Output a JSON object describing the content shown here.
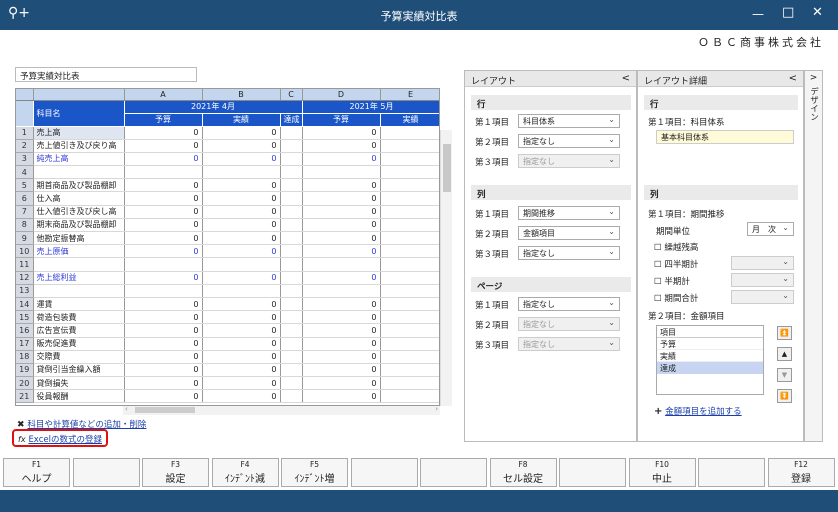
{
  "window": {
    "title": "予算実績対比表",
    "company": "ＯＢＣ商事株式会社"
  },
  "sheet": {
    "name": "予算実績対比表",
    "columns": [
      "A",
      "B",
      "C",
      "D",
      "E"
    ],
    "periods": [
      "2021年 4月",
      "2021年 5月"
    ],
    "subheaders": {
      "account": "科目名",
      "budget": "予算",
      "actual": "実績",
      "rate": "達成"
    },
    "rows": [
      {
        "n": "1",
        "label": "売上高",
        "a": "0",
        "b": "0",
        "d": "0",
        "blue": false
      },
      {
        "n": "2",
        "label": "売上値引き及び戻り高",
        "a": "0",
        "b": "0",
        "d": "0",
        "blue": false
      },
      {
        "n": "3",
        "label": "純売上高",
        "a": "0",
        "b": "0",
        "d": "0",
        "blue": true
      },
      {
        "n": "4",
        "label": "",
        "a": "",
        "b": "",
        "d": "",
        "blue": false
      },
      {
        "n": "5",
        "label": "期首商品及び製品棚卸",
        "a": "0",
        "b": "0",
        "d": "0",
        "blue": false
      },
      {
        "n": "6",
        "label": "仕入高",
        "a": "0",
        "b": "0",
        "d": "0",
        "blue": false
      },
      {
        "n": "7",
        "label": "仕入値引き及び戻し高",
        "a": "0",
        "b": "0",
        "d": "0",
        "blue": false
      },
      {
        "n": "8",
        "label": "期末商品及び製品棚卸",
        "a": "0",
        "b": "0",
        "d": "0",
        "blue": false
      },
      {
        "n": "9",
        "label": "他勘定振替高",
        "a": "0",
        "b": "0",
        "d": "0",
        "blue": false
      },
      {
        "n": "10",
        "label": "売上原価",
        "a": "0",
        "b": "0",
        "d": "0",
        "blue": true
      },
      {
        "n": "11",
        "label": "",
        "a": "",
        "b": "",
        "d": "",
        "blue": false
      },
      {
        "n": "12",
        "label": "売上総利益",
        "a": "0",
        "b": "0",
        "d": "0",
        "blue": true
      },
      {
        "n": "13",
        "label": "",
        "a": "",
        "b": "",
        "d": "",
        "blue": false
      },
      {
        "n": "14",
        "label": "運賃",
        "a": "0",
        "b": "0",
        "d": "0",
        "blue": false
      },
      {
        "n": "15",
        "label": "荷造包装費",
        "a": "0",
        "b": "0",
        "d": "0",
        "blue": false
      },
      {
        "n": "16",
        "label": "広告宣伝費",
        "a": "0",
        "b": "0",
        "d": "0",
        "blue": false
      },
      {
        "n": "17",
        "label": "販売促進費",
        "a": "0",
        "b": "0",
        "d": "0",
        "blue": false
      },
      {
        "n": "18",
        "label": "交際費",
        "a": "0",
        "b": "0",
        "d": "0",
        "blue": false
      },
      {
        "n": "19",
        "label": "貸倒引当金繰入額",
        "a": "0",
        "b": "0",
        "d": "0",
        "blue": false
      },
      {
        "n": "20",
        "label": "貸倒損失",
        "a": "0",
        "b": "0",
        "d": "0",
        "blue": false
      },
      {
        "n": "21",
        "label": "役員報酬",
        "a": "0",
        "b": "0",
        "d": "0",
        "blue": false
      }
    ]
  },
  "links": {
    "add_accounts": "科目や計算値などの追加・削除",
    "excel_formula": "Excelの数式の登録"
  },
  "layout": {
    "title": "レイアウト",
    "row_section": "行",
    "col_section": "列",
    "page_section": "ページ",
    "item1": "第１項目",
    "item2": "第２項目",
    "item3": "第３項目",
    "row_vals": [
      "科目体系",
      "指定なし",
      "指定なし"
    ],
    "col_vals": [
      "期間推移",
      "金額項目",
      "指定なし"
    ],
    "page_vals": [
      "指定なし",
      "指定なし",
      "指定なし"
    ]
  },
  "detail": {
    "title": "レイアウト詳細",
    "row_section": "行",
    "row_item": "第１項目：科目体系",
    "row_value": "基本科目体系",
    "col_section": "列",
    "col_item1": "第１項目：期間推移",
    "period_unit_label": "期間単位",
    "period_unit_value": "月　次",
    "checks": [
      "繰越残高",
      "四半期計",
      "半期計",
      "期間合計"
    ],
    "col_item2": "第２項目：金額項目",
    "list_header": "項目",
    "list_items": [
      "予算",
      "実績",
      "達成"
    ],
    "add_link": "金額項目を追加する"
  },
  "design_tab": "デザイン",
  "fkeys": [
    {
      "k": "F1",
      "l": "ヘルプ"
    },
    {
      "k": "",
      "l": ""
    },
    {
      "k": "F3",
      "l": "設定"
    },
    {
      "k": "F4",
      "l": "ｲﾝﾃﾞﾝﾄ減"
    },
    {
      "k": "F5",
      "l": "ｲﾝﾃﾞﾝﾄ増"
    },
    {
      "k": "",
      "l": ""
    },
    {
      "k": "",
      "l": ""
    },
    {
      "k": "F8",
      "l": "セル設定"
    },
    {
      "k": "",
      "l": ""
    },
    {
      "k": "F10",
      "l": "中止"
    },
    {
      "k": "",
      "l": ""
    },
    {
      "k": "F12",
      "l": "登録"
    }
  ],
  "colors": {
    "titlebar": "#1f4e79",
    "header_blue": "#1b56c8",
    "highlight_red": "#e01010"
  }
}
